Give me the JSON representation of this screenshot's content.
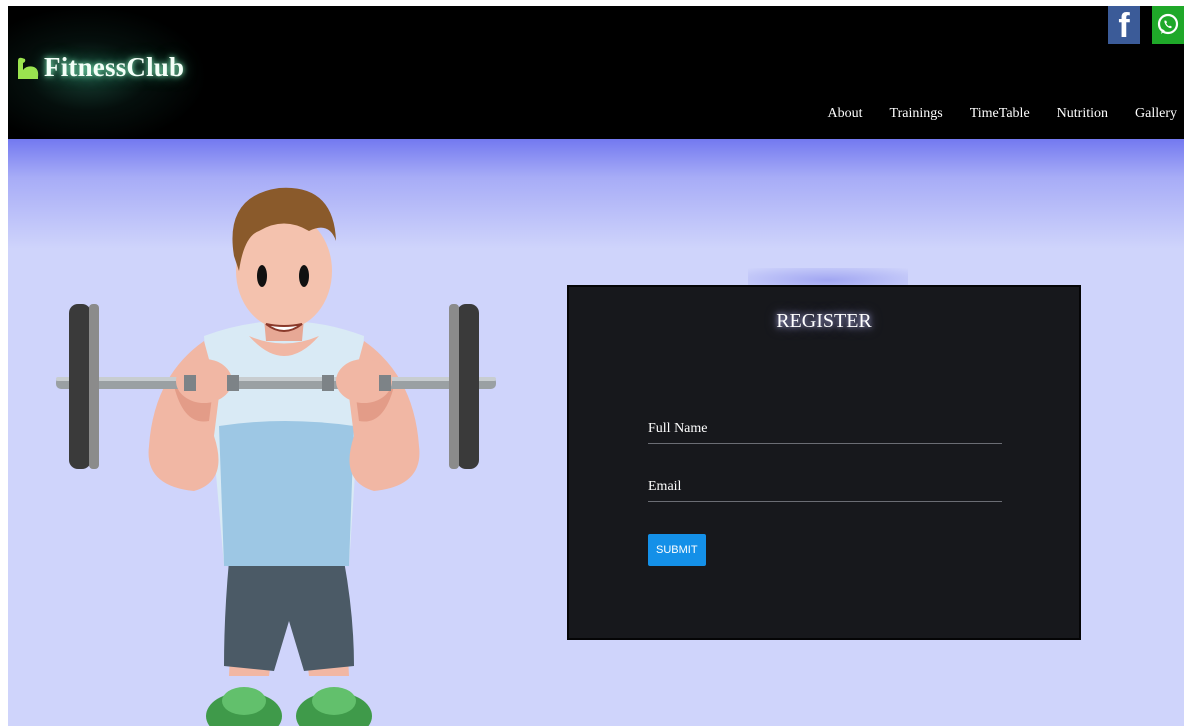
{
  "header": {
    "brand": "FitnessClub",
    "nav": [
      "About",
      "Trainings",
      "TimeTable",
      "Nutrition",
      "Gallery"
    ],
    "social": [
      {
        "name": "facebook",
        "icon": "facebook-icon",
        "glyph": "f",
        "color": "#3b5b98"
      },
      {
        "name": "whatsapp",
        "icon": "whatsapp-icon",
        "color": "#1fa829"
      }
    ]
  },
  "register": {
    "title": "REGISTER",
    "full_name_placeholder": "Full Name",
    "email_placeholder": "Email",
    "submit_label": "SUBMIT"
  },
  "colors": {
    "header_bg": "#000000",
    "page_bg": "#cfd4fb",
    "card_bg": "#17181c",
    "submit_bg": "#1490e8",
    "brand_icon": "#9be34f"
  },
  "hero": {
    "illustration": "weightlifter-illustration"
  }
}
